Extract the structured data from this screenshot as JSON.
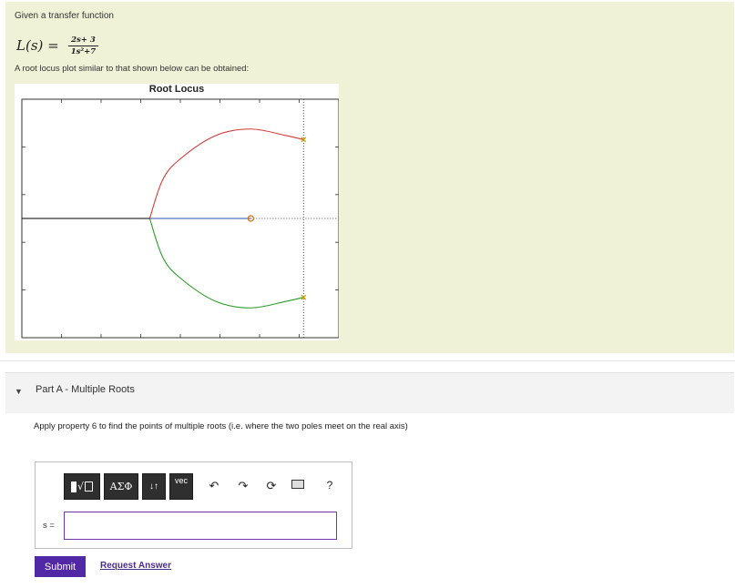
{
  "problem": {
    "intro": "Given a transfer function",
    "tf_lhs": "L(s) =",
    "tf_num": "2s+ 3",
    "tf_den": "1s²+7",
    "lead": "A root locus plot similar to that shown below can be obtained:"
  },
  "chart_data": {
    "type": "line",
    "title": "Root Locus",
    "xlabel": "",
    "ylabel": "",
    "grid": false,
    "poles": [
      {
        "re": 0,
        "im": 2.6458
      },
      {
        "re": 0,
        "im": -2.6458
      }
    ],
    "zeros": [
      {
        "re": -1.5,
        "im": 0
      }
    ],
    "series": [
      {
        "color": "#d23a3a",
        "description_branch": "upper",
        "points": [
          [
            0,
            2.6458
          ],
          [
            -0.5,
            2.78
          ],
          [
            -1.5,
            3.0
          ],
          [
            -2.5,
            2.78
          ],
          [
            -3.5,
            2.0
          ],
          [
            -4.0,
            1.3
          ],
          [
            -4.37,
            0
          ]
        ]
      },
      {
        "color": "#2a9c2a",
        "description_branch": "lower",
        "points": [
          [
            0,
            -2.6458
          ],
          [
            -0.5,
            -2.78
          ],
          [
            -1.5,
            -3.0
          ],
          [
            -2.5,
            -2.78
          ],
          [
            -3.5,
            -2.0
          ],
          [
            -4.0,
            -1.3
          ],
          [
            -4.37,
            0
          ]
        ]
      },
      {
        "color": "#2b4fb5",
        "description_branch": "real-axis",
        "points": [
          [
            -4.37,
            0
          ],
          [
            -1.5,
            0
          ]
        ]
      },
      {
        "color": "#000000",
        "description_branch": "real-axis",
        "points": [
          [
            -8,
            0
          ],
          [
            -4.37,
            0
          ]
        ]
      }
    ],
    "xlim": [
      -8,
      1
    ],
    "ylim": [
      -4,
      4
    ],
    "colors": {
      "pole_marker": "#c8a000",
      "zero_marker": "#d86a00",
      "asymptote": "#555555"
    }
  },
  "part": {
    "caret": "▼",
    "title": "Part A - Multiple Roots",
    "instruction": "Apply property 6 to find the points of multiple roots (i.e. where the two poles meet on the real axis)"
  },
  "answer": {
    "toolbar": {
      "templates_icon": "square-root-template-icon",
      "symbols_label": "ΑΣΦ",
      "order_label": "↓↑",
      "vec_label": "vec",
      "undo_icon": "↶",
      "redo_icon": "↷",
      "reset_icon": "⟳",
      "keyboard_icon": "keyboard-icon",
      "help_label": "?"
    },
    "variable_label": "s =",
    "input_value": ""
  },
  "actions": {
    "submit_label": "Submit",
    "request_label": "Request Answer"
  }
}
